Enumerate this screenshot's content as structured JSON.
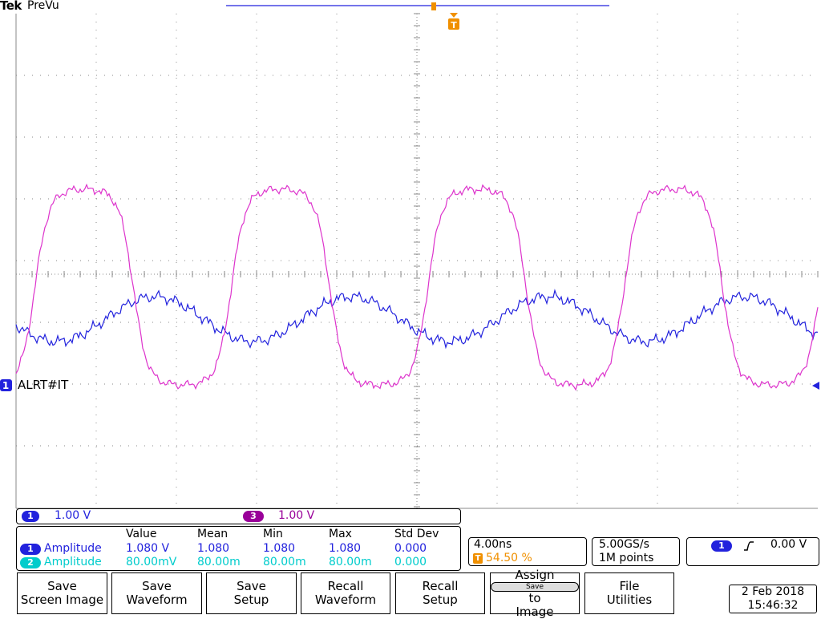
{
  "header": {
    "logo": "Tek",
    "mode": "PreVu"
  },
  "trigger_marker": {
    "label": "T"
  },
  "channel_marker": {
    "number": "1",
    "label": "ALRT#IT"
  },
  "colors": {
    "ch1": "#2222dd",
    "ch2": "#00cccc",
    "ch3": "#dd33cc",
    "trigger": "#f09000",
    "grid": "#888888"
  },
  "channels": [
    {
      "number": "1",
      "scale": "1.00 V",
      "color": "#2222dd"
    },
    {
      "number": "3",
      "scale": "1.00 V",
      "color": "#990099"
    }
  ],
  "measurements": {
    "headers": [
      "Value",
      "Mean",
      "Min",
      "Max",
      "Std Dev"
    ],
    "rows": [
      {
        "channel": "1",
        "name": "Amplitude",
        "value": "1.080 V",
        "mean": "1.080",
        "min": "1.080",
        "max": "1.080",
        "stddev": "0.000",
        "color": "#2222dd"
      },
      {
        "channel": "2",
        "name": "Amplitude",
        "value": "80.00mV",
        "mean": "80.00m",
        "min": "80.00m",
        "max": "80.00m",
        "stddev": "0.000",
        "color": "#00cccc"
      }
    ]
  },
  "timebase": {
    "scale": "4.00ns",
    "trigger_pos": "54.50 %"
  },
  "acquisition": {
    "rate": "5.00GS/s",
    "length": "1M points"
  },
  "trigger": {
    "channel": "1",
    "slope_icon": "rising-edge-icon",
    "level": "0.00 V"
  },
  "softkeys": [
    {
      "line1": "Save",
      "line2": "Screen Image"
    },
    {
      "line1": "Save",
      "line2": "Waveform"
    },
    {
      "line1": "Save",
      "line2": "Setup"
    },
    {
      "line1": "Recall",
      "line2": "Waveform"
    },
    {
      "line1": "Recall",
      "line2": "Setup"
    },
    {
      "line1": "Assign",
      "badge": "Save",
      "word": "to",
      "line3": "Image"
    },
    {
      "line1": "File",
      "line2": "Utilities"
    }
  ],
  "datetime": {
    "date": "2 Feb  2018",
    "time": "15:46:32"
  }
}
